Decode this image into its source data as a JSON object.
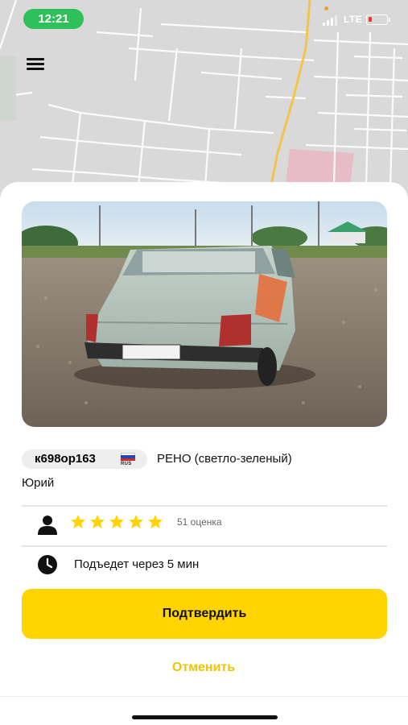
{
  "status_bar": {
    "time": "12:21",
    "network": "LTE",
    "battery_level": 0.1
  },
  "map": {
    "background_color": "#dcdcdc",
    "road_color": "#f0c040"
  },
  "menu": {
    "icon": "hamburger-menu-icon"
  },
  "car": {
    "photo_description_icon": "car-photo",
    "plate": "к698ор163",
    "plate_region": "RUS",
    "model": "РЕНО (светло-зеленый)"
  },
  "driver": {
    "name": "Юрий",
    "rating_stars": 5,
    "rating_count_label": "51 оценка"
  },
  "eta": {
    "text": "Подъедет через 5 мин"
  },
  "actions": {
    "confirm_label": "Подтвердить",
    "cancel_label": "Отменить"
  },
  "colors": {
    "accent": "#ffd400",
    "cancel_text": "#f0c400",
    "status_pill": "#2ec05a",
    "star": "#ffd400"
  }
}
